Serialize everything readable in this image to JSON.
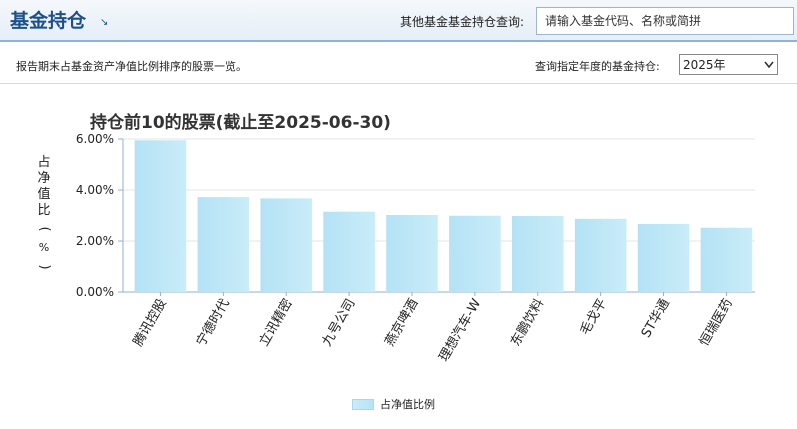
{
  "header": {
    "title": "基金持仓",
    "corner_icon": "corner-arrow-icon",
    "search_label": "其他基金基金持仓查询:",
    "search_placeholder": "请输入基金代码、名称或简拼"
  },
  "subbar": {
    "description": "报告期末占基金资产净值比例排序的股票一览。",
    "year_label": "查询指定年度的基金持仓:",
    "year_selected": "2025年"
  },
  "colors": {
    "bar_fill_light": "#c9ecf8",
    "bar_fill_dark": "#b4e2f5",
    "header_text": "#1d4f8a",
    "axis": "#8fb2d6"
  },
  "chart_data": {
    "type": "bar",
    "title": "持仓前10的股票(截止至2025-06-30)",
    "ylabel": "占净值比(%)",
    "ylabel_chars": [
      "占",
      "净",
      "值",
      "比",
      "(",
      "%",
      ")"
    ],
    "categories": [
      "腾讯控股",
      "宁德时代",
      "立讯精密",
      "九号公司",
      "燕京啤酒",
      "理想汽车-W",
      "东鹏饮料",
      "毛戈平",
      "ST华通",
      "恒瑞医药"
    ],
    "values": [
      5.95,
      3.72,
      3.67,
      3.15,
      3.02,
      2.99,
      2.98,
      2.87,
      2.67,
      2.52
    ],
    "ylim": [
      0,
      6
    ],
    "yticks": [
      "0.00%",
      "2.00%",
      "4.00%",
      "6.00%"
    ],
    "ytick_values": [
      0,
      2,
      4,
      6
    ],
    "grid": true,
    "legend": {
      "position": "bottom",
      "entries": [
        "占净值比例"
      ]
    }
  }
}
